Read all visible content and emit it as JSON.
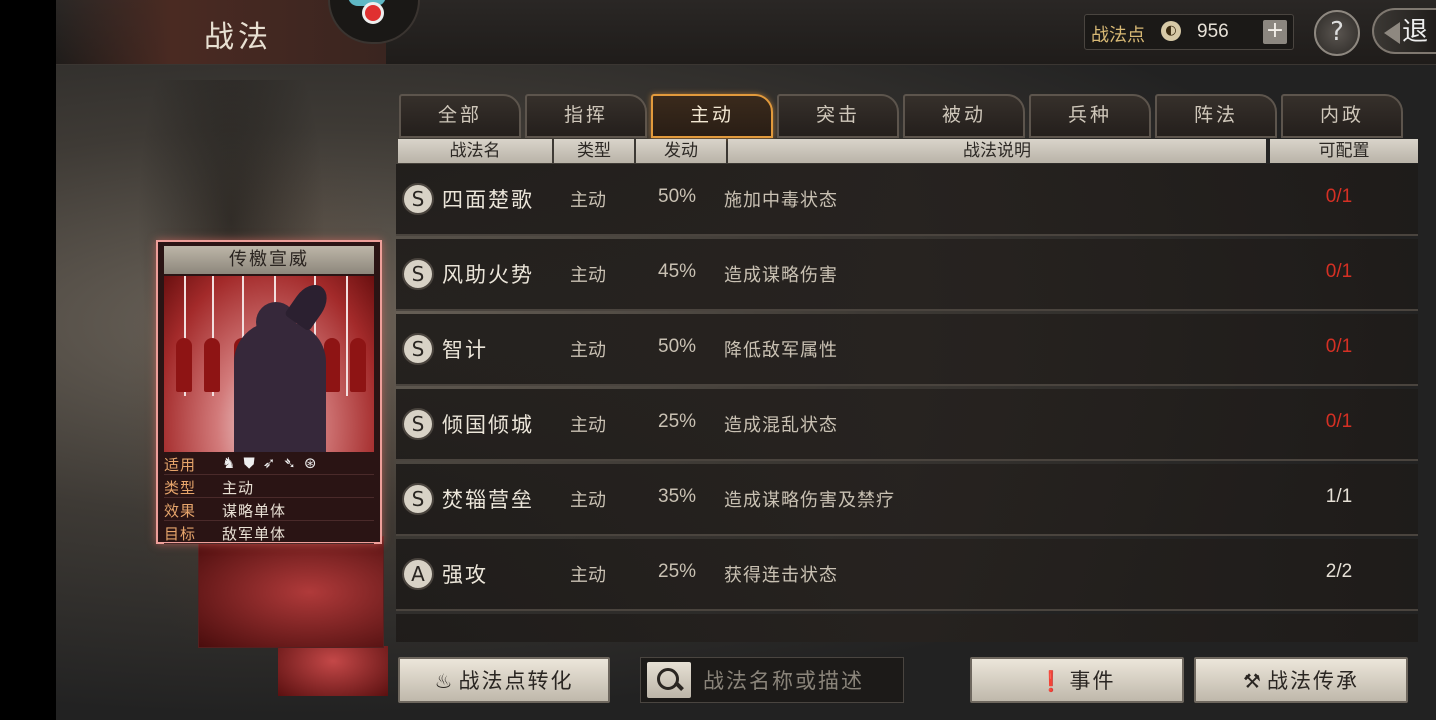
{
  "header": {
    "title": "战法",
    "points_label": "战法点",
    "points_value": "956",
    "plus": "+",
    "help": "?",
    "back": "退"
  },
  "tabs": [
    "全部",
    "指挥",
    "主动",
    "突击",
    "被动",
    "兵种",
    "阵法",
    "内政"
  ],
  "active_tab": "主动",
  "columns": [
    "战法名",
    "类型",
    "发动",
    "战法说明",
    "可配置"
  ],
  "rows": [
    {
      "grade": "S",
      "name": "四面楚歌",
      "type": "主动",
      "rate": "50%",
      "desc": "施加中毒状态",
      "avail": "0/1"
    },
    {
      "grade": "S",
      "name": "风助火势",
      "type": "主动",
      "rate": "45%",
      "desc": "造成谋略伤害",
      "avail": "0/1"
    },
    {
      "grade": "S",
      "name": "智计",
      "type": "主动",
      "rate": "50%",
      "desc": "降低敌军属性",
      "avail": "0/1"
    },
    {
      "grade": "S",
      "name": "倾国倾城",
      "type": "主动",
      "rate": "25%",
      "desc": "造成混乱状态",
      "avail": "0/1"
    },
    {
      "grade": "S",
      "name": "焚辎营垒",
      "type": "主动",
      "rate": "35%",
      "desc": "造成谋略伤害及禁疗",
      "avail": "1/1"
    },
    {
      "grade": "A",
      "name": "强攻",
      "type": "主动",
      "rate": "25%",
      "desc": "获得连击状态",
      "avail": "2/2"
    }
  ],
  "card": {
    "title": "传檄宣威",
    "applicable_label": "适用",
    "applicable_troops": [
      "cavalry-icon",
      "shield-icon",
      "bow-icon",
      "spear-icon",
      "vehicle-icon"
    ],
    "type_label": "类型",
    "type_value": "主动",
    "effect_label": "效果",
    "effect_value": "谋略单体",
    "target_label": "目标",
    "target_value": "敌军单体"
  },
  "bottom": {
    "convert_label": "战法点转化",
    "search_placeholder": "战法名称或描述",
    "events_label": "事件",
    "inherit_label": "战法传承"
  },
  "colors": {
    "accent": "#e29a3c",
    "unavailable": "#d53024",
    "card_border": "#ee9f9a"
  }
}
